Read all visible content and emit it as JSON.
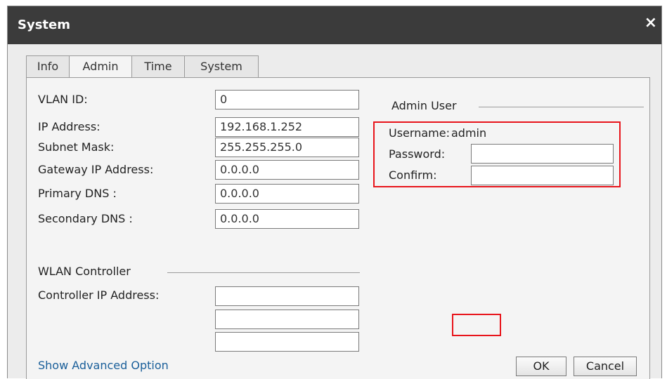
{
  "window": {
    "title": "System",
    "close_glyph": "×"
  },
  "tabs": [
    {
      "label": "Info"
    },
    {
      "label": "Admin"
    },
    {
      "label": "Time"
    },
    {
      "label": "System"
    }
  ],
  "network": {
    "vlan_id": {
      "label": "VLAN ID:",
      "value": "0"
    },
    "ip_address": {
      "label": "IP Address:",
      "value": "192.168.1.252"
    },
    "subnet_mask": {
      "label": "Subnet Mask:",
      "value": "255.255.255.0"
    },
    "gateway": {
      "label": "Gateway IP Address:",
      "value": "0.0.0.0"
    },
    "primary_dns": {
      "label": "Primary DNS :",
      "value": "0.0.0.0"
    },
    "secondary_dns": {
      "label": "Secondary DNS :",
      "value": "0.0.0.0"
    }
  },
  "admin_user": {
    "legend": "Admin User",
    "username_label": "Username:",
    "username_value": "admin",
    "password_label": "Password:",
    "password_value": "",
    "confirm_label": "Confirm:",
    "confirm_value": ""
  },
  "wlan_controller": {
    "legend": "WLAN Controller",
    "controller_ip_label": "Controller IP Address:",
    "controller_ip_1": "",
    "controller_ip_2": "",
    "controller_ip_3": ""
  },
  "footer": {
    "advanced_link": "Show Advanced Option",
    "ok_label": "OK",
    "cancel_label": "Cancel"
  },
  "colors": {
    "titlebar": "#3b3b3b",
    "highlight_box": "#e8141b",
    "link": "#1a5f9a"
  }
}
